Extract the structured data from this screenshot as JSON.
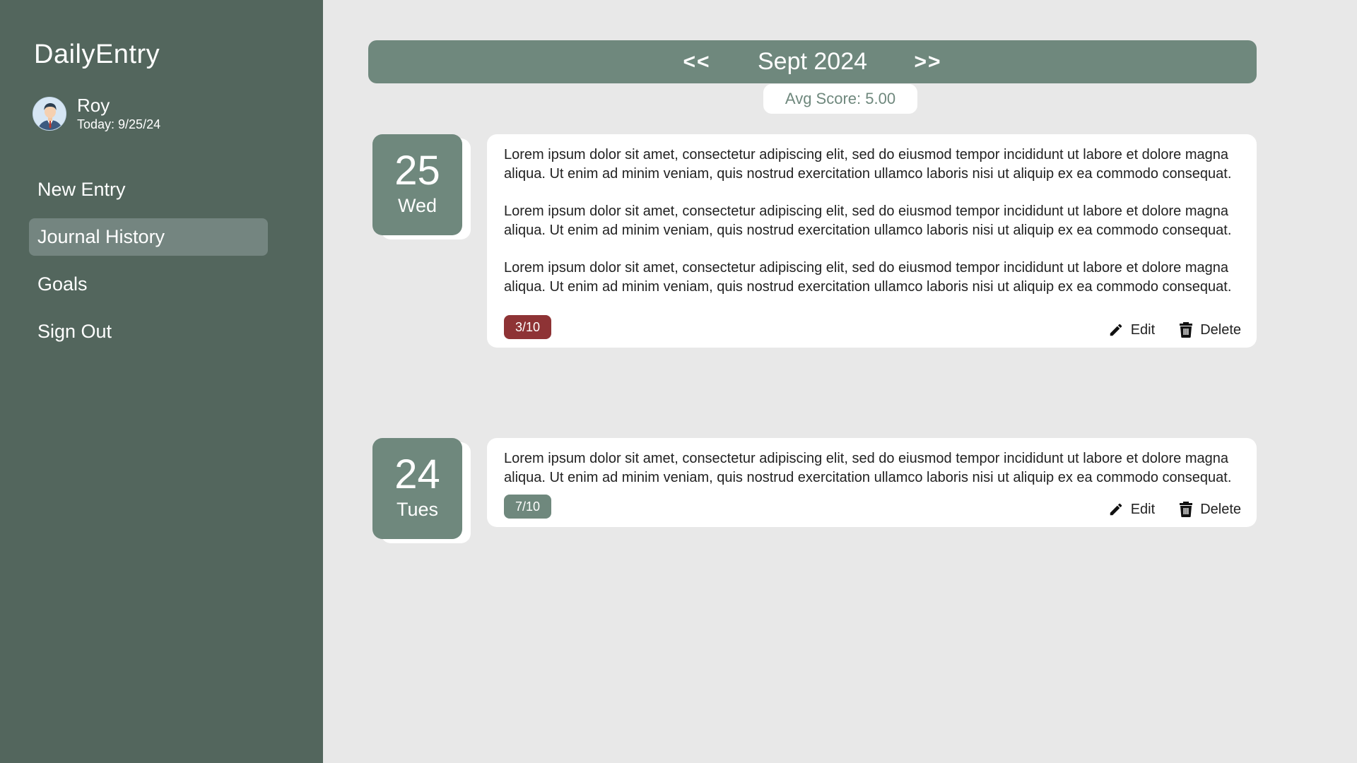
{
  "app": {
    "title": "DailyEntry"
  },
  "user": {
    "name": "Roy",
    "today": "Today: 9/25/24"
  },
  "nav": {
    "items": [
      {
        "label": "New Entry"
      },
      {
        "label": "Journal History",
        "active": true
      },
      {
        "label": "Goals"
      },
      {
        "label": "Sign Out"
      }
    ]
  },
  "header": {
    "prev": "<<",
    "month": "Sept 2024",
    "next": ">>",
    "avg_score": "Avg Score: 5.00"
  },
  "entries": [
    {
      "day": "25",
      "weekday": "Wed",
      "paragraphs": [
        "Lorem ipsum dolor sit amet, consectetur adipiscing elit, sed do eiusmod tempor incididunt ut labore et dolore magna aliqua. Ut enim ad minim veniam, quis nostrud exercitation ullamco laboris nisi ut aliquip ex ea commodo consequat.",
        "Lorem ipsum dolor sit amet, consectetur adipiscing elit, sed do eiusmod tempor incididunt ut labore et dolore magna aliqua. Ut enim ad minim veniam, quis nostrud exercitation ullamco laboris nisi ut aliquip ex ea commodo consequat.",
        "Lorem ipsum dolor sit amet, consectetur adipiscing elit, sed do eiusmod tempor incididunt ut labore et dolore magna aliqua. Ut enim ad minim veniam, quis nostrud exercitation ullamco laboris nisi ut aliquip ex ea commodo consequat."
      ],
      "score": "3/10",
      "score_color": "#8e3335",
      "edit_label": "Edit",
      "delete_label": "Delete"
    },
    {
      "day": "24",
      "weekday": "Tues",
      "paragraphs": [
        "Lorem ipsum dolor sit amet, consectetur adipiscing elit, sed do eiusmod tempor incididunt ut labore et dolore magna aliqua. Ut enim ad minim veniam, quis nostrud exercitation ullamco laboris nisi ut aliquip ex ea commodo consequat."
      ],
      "score": "7/10",
      "score_color": "#6f887d",
      "edit_label": "Edit",
      "delete_label": "Delete"
    }
  ],
  "colors": {
    "sidebar": "#53665d",
    "accent": "#6f887d",
    "nav_active": "#748580",
    "background": "#e8e8e8"
  },
  "icons": {
    "edit": "pencil-icon",
    "delete": "trash-icon",
    "avatar": "user-avatar"
  }
}
